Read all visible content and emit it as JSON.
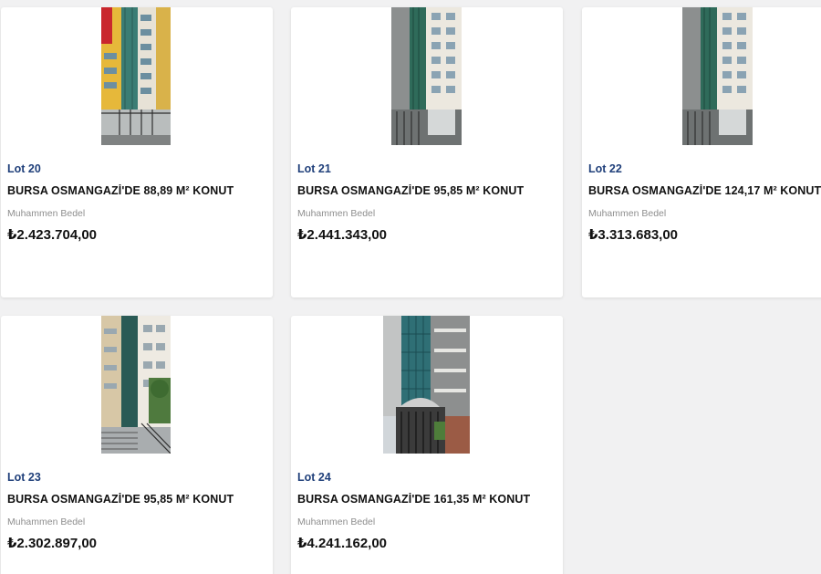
{
  "lots": [
    {
      "lot": "Lot 20",
      "title": "BURSA OSMANGAZİ'DE 88,89 M² KONUT",
      "price_label": "Muhammen Bedel",
      "price": "₺2.423.704,00"
    },
    {
      "lot": "Lot 21",
      "title": "BURSA OSMANGAZİ'DE 95,85 M² KONUT",
      "price_label": "Muhammen Bedel",
      "price": "₺2.441.343,00"
    },
    {
      "lot": "Lot 22",
      "title": "BURSA OSMANGAZİ'DE 124,17 M² KONUT",
      "price_label": "Muhammen Bedel",
      "price": "₺3.313.683,00"
    },
    {
      "lot": "Lot 23",
      "title": "BURSA OSMANGAZİ'DE 95,85 M² KONUT",
      "price_label": "Muhammen Bedel",
      "price": "₺2.302.897,00"
    },
    {
      "lot": "Lot 24",
      "title": "BURSA OSMANGAZİ'DE 161,35 M² KONUT",
      "price_label": "Muhammen Bedel",
      "price": "₺4.241.162,00"
    }
  ],
  "colors": {
    "page_background": "#f1f1f2",
    "lot_number": "#1f3f7a",
    "label": "#8e8e8e"
  }
}
